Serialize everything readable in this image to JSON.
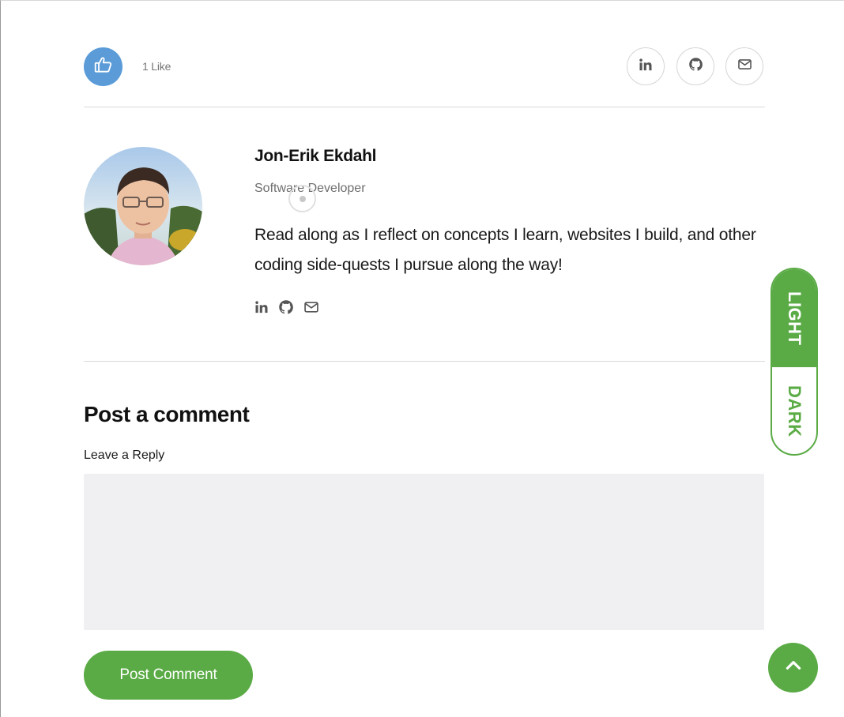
{
  "likes": {
    "count_label": "1 Like"
  },
  "share": {
    "icons": [
      "linkedin-icon",
      "github-icon",
      "envelope-icon"
    ]
  },
  "author": {
    "name": "Jon-Erik Ekdahl",
    "role": "Software Developer",
    "bio": "Read along as I reflect on concepts I learn, websites I build, and other coding side-quests I pursue along the way!",
    "social_icons": [
      "linkedin-icon",
      "github-icon",
      "envelope-icon"
    ]
  },
  "comment": {
    "heading": "Post a comment",
    "reply_label": "Leave a Reply",
    "reply_value": "",
    "submit_label": "Post Comment"
  },
  "theme_toggle": {
    "light_label": "LIGHT",
    "dark_label": "DARK",
    "active": "light"
  },
  "colors": {
    "accent": "#5aab45",
    "like_blue": "#5a9bd8",
    "field_bg": "#f0f0f3"
  }
}
